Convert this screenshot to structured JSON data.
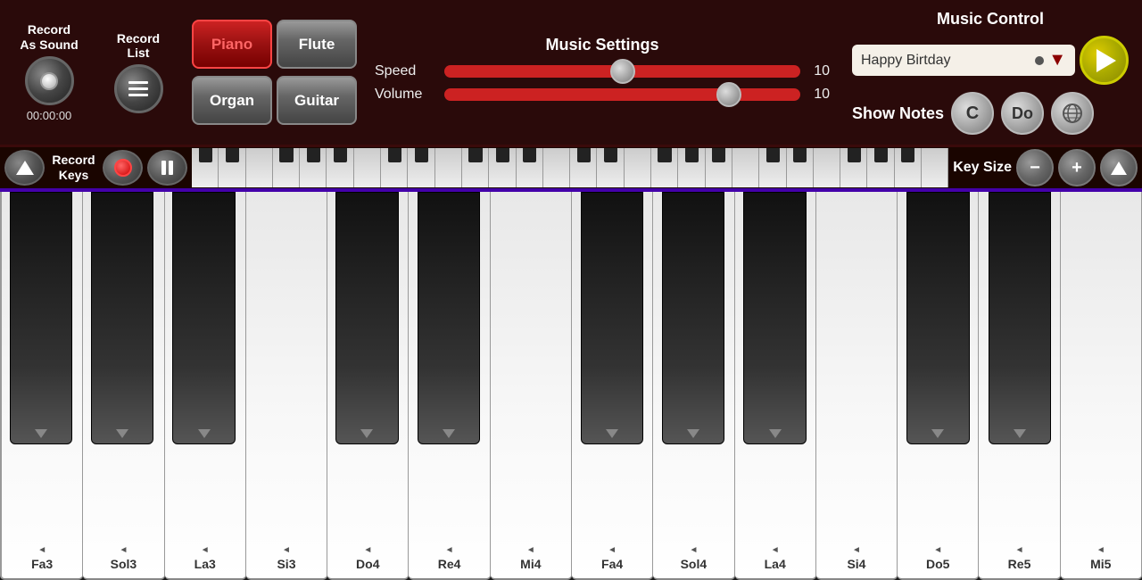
{
  "top_bar": {
    "record_as_sound": {
      "line1": "Record",
      "line2": "As Sound",
      "timer": "00:00:00"
    },
    "record_list": {
      "line1": "Record",
      "line2": "List"
    },
    "instruments": [
      {
        "label": "Piano",
        "active": true
      },
      {
        "label": "Flute",
        "active": false
      },
      {
        "label": "Organ",
        "active": false
      },
      {
        "label": "Guitar",
        "active": false
      }
    ],
    "music_settings": {
      "title": "Music Settings",
      "speed_label": "Speed",
      "speed_value": "10",
      "volume_label": "Volume",
      "volume_value": "10"
    },
    "music_control": {
      "title": "Music Control",
      "song_name": "Happy Birtday",
      "show_notes_label": "Show Notes",
      "note_c": "C",
      "note_do": "Do"
    }
  },
  "keyboard_bar": {
    "record_keys_label": "Record\nKeys",
    "key_size_label": "Key Size"
  },
  "piano": {
    "white_keys": [
      {
        "note": "Fa3"
      },
      {
        "note": "Sol3"
      },
      {
        "note": "La3"
      },
      {
        "note": "Si3"
      },
      {
        "note": "Do4"
      },
      {
        "note": "Re4"
      },
      {
        "note": "Mi4"
      },
      {
        "note": "Fa4"
      },
      {
        "note": "Sol4"
      },
      {
        "note": "La4"
      },
      {
        "note": "Si4"
      },
      {
        "note": "Do5"
      },
      {
        "note": "Re5"
      },
      {
        "note": "Mi5"
      }
    ]
  }
}
